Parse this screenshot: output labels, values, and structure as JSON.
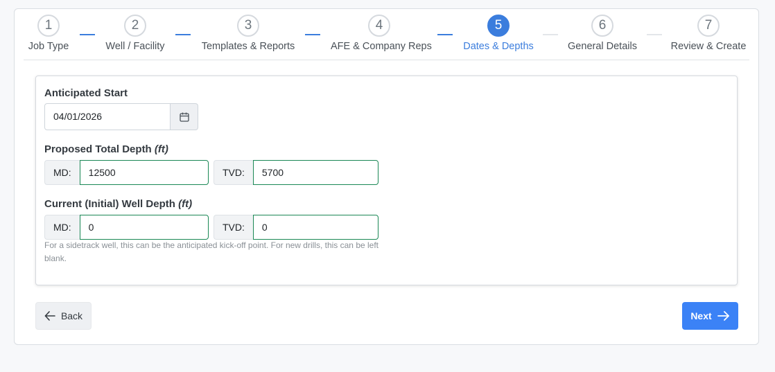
{
  "stepper": {
    "steps": [
      {
        "number": "1",
        "label": "Job Type"
      },
      {
        "number": "2",
        "label": "Well / Facility"
      },
      {
        "number": "3",
        "label": "Templates & Reports"
      },
      {
        "number": "4",
        "label": "AFE & Company Reps"
      },
      {
        "number": "5",
        "label": "Dates & Depths"
      },
      {
        "number": "6",
        "label": "General Details"
      },
      {
        "number": "7",
        "label": "Review & Create"
      }
    ],
    "active_step": 5
  },
  "form": {
    "anticipated_start": {
      "label": "Anticipated Start",
      "value": "04/01/2026",
      "icon": "calendar-icon"
    },
    "proposed_total_depth": {
      "label": "Proposed Total Depth",
      "unit": "(ft)",
      "md_label": "MD:",
      "md_value": "12500",
      "tvd_label": "TVD:",
      "tvd_value": "5700"
    },
    "current_well_depth": {
      "label": "Current (Initial) Well Depth",
      "unit": "(ft)",
      "md_label": "MD:",
      "md_value": "0",
      "tvd_label": "TVD:",
      "tvd_value": "0",
      "help_text": "For a sidetrack well, this can be the anticipated kick-off point. For new drills, this can be left blank."
    }
  },
  "actions": {
    "back_label": "Back",
    "next_label": "Next"
  },
  "colors": {
    "accent": "#3b82f6",
    "active_step": "#3b7ddd",
    "valid_border": "#198754"
  }
}
